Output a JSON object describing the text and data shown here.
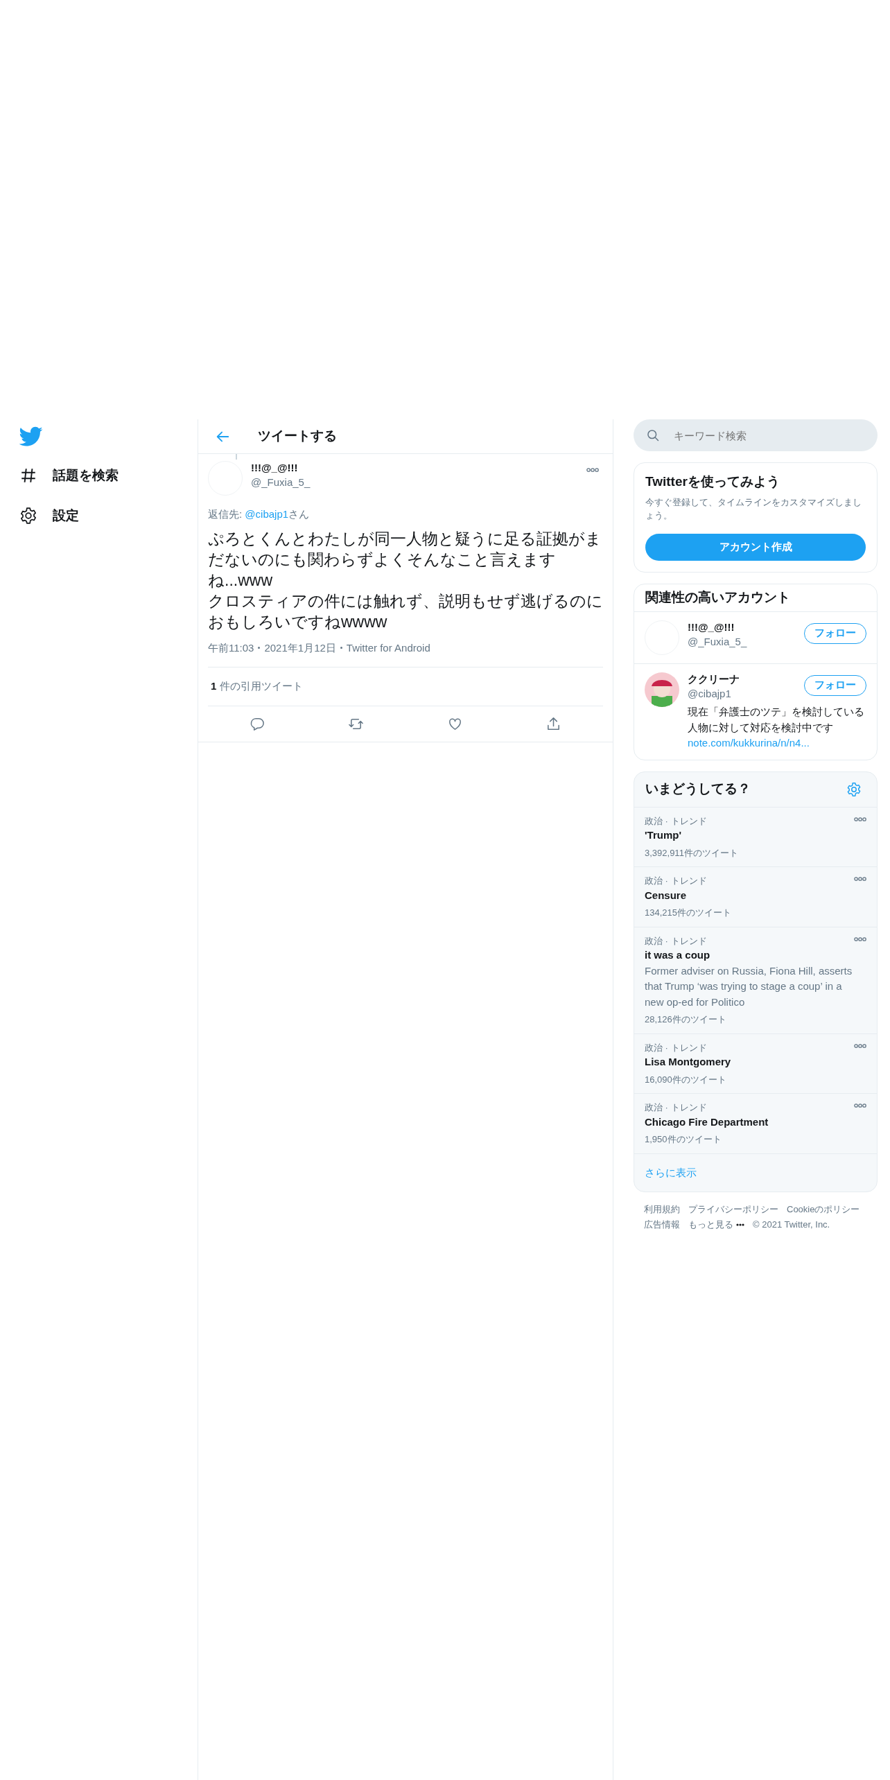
{
  "sidebar": {
    "items": [
      {
        "label": "話題を検索"
      },
      {
        "label": "設定"
      }
    ]
  },
  "header": {
    "title": "ツイートする"
  },
  "tweet": {
    "name": "!!!@_@!!!",
    "handle": "@_Fuxia_5_",
    "reply": {
      "prefix": "返信先: ",
      "mention": "@cibajp1",
      "suffix": "さん"
    },
    "text": "ぷろとくんとわたしが同一人物と疑うに足る証拠がまだないのにも関わらずよくそんなこと言えますね...www\nクロスティアの件には触れず、説明もせず逃げるのにおもしろいですねwwww",
    "meta": [
      "午前11:03",
      "2021年1月12日",
      "Twitter for Android"
    ],
    "quote_count": "1",
    "quote_label": "件の引用ツイート"
  },
  "search": {
    "placeholder": "キーワード検索"
  },
  "signup": {
    "title": "Twitterを使ってみよう",
    "text": "今すぐ登録して、タイムラインをカスタマイズしましょう。",
    "button": "アカウント作成"
  },
  "related": {
    "title": "関連性の高いアカウント",
    "accounts": [
      {
        "has_picture": false,
        "name": "!!!@_@!!!",
        "handle": "@_Fuxia_5_",
        "button": "フォロー"
      },
      {
        "has_picture": true,
        "name": "ククリーナ",
        "handle": "@cibajp1",
        "bio": "現在「弁護士のツテ」を検討している人物に対して対応を検討中です",
        "link": "note.com/kukkurina/n/n4...",
        "button": "フォロー"
      }
    ]
  },
  "trends": {
    "title": "いまどうしてる？",
    "items": [
      {
        "context": "政治 · トレンド",
        "name": "'Trump'",
        "count": "3,392,911件のツイート"
      },
      {
        "context": "政治 · トレンド",
        "name": "Censure",
        "count": "134,215件のツイート"
      },
      {
        "context": "政治 · トレンド",
        "name": "it was a coup",
        "description": "Former adviser on Russia, Fiona Hill, asserts that Trump ‘was trying to stage a coup’ in a new op-ed for Politico",
        "count": "28,126件のツイート"
      },
      {
        "context": "政治 · トレンド",
        "name": "Lisa Montgomery",
        "count": "16,090件のツイート"
      },
      {
        "context": "政治 · トレンド",
        "name": "Chicago Fire Department",
        "count": "1,950件のツイート"
      }
    ],
    "more": "さらに表示"
  },
  "footer": {
    "links": [
      "利用規約",
      "プライバシーポリシー",
      "Cookieのポリシー",
      "広告情報",
      "もっと見る"
    ],
    "copyright": "© 2021 Twitter, Inc."
  }
}
